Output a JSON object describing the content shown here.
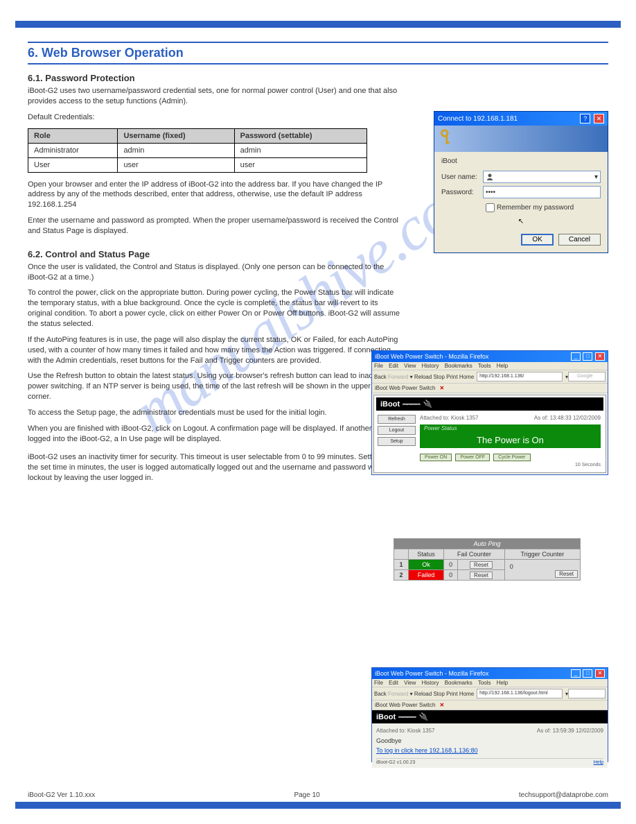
{
  "section_number": "6.",
  "section_title": "Web Browser Operation",
  "sub1_title": "6.1. Password Protection",
  "sub1_p1": "iBoot-G2 uses two username/password credential sets, one for normal power control (User) and one that also provides access to the setup functions (Admin).",
  "sub1_p2": "Default Credentials:",
  "cred_headers": {
    "c1": "Role",
    "c2": "Username (fixed)",
    "c3": "Password (settable)"
  },
  "cred_rows": [
    {
      "role": "Administrator",
      "user": "admin",
      "pass": "admin"
    },
    {
      "role": "User",
      "user": "user",
      "pass": "user"
    }
  ],
  "sub1_p3": "Open your browser and enter the IP address of iBoot-G2 into the address bar. If you have changed the IP address by any of the methods described, enter that address, otherwise, use the default IP address 192.168.1.254",
  "sub1_p4": "Enter the username and password as prompted. When the proper username/password is received the Control and Status Page is displayed.",
  "sub2_title": "6.2. Control and Status Page",
  "sub2_p1": "Once the user is validated, the Control and Status is displayed. (Only one person can be connected to the iBoot-G2 at a time.)",
  "sub2_p2": "To control the power, click on the appropriate button. During power cycling, the Power Status bar will indicate the temporary status, with a blue background. Once the cycle is complete, the status bar will revert to its original condition. To abort a power cycle, click on either Power On or Power Off buttons. iBoot-G2 will assume the status selected.",
  "sub2_p3": "If the AutoPing features is in use, the page will also display the current status, OK or Failed, for each AutoPing used, with a counter of how many times it failed and how many times the Action was triggered. If connecting with the Admin credentials, reset buttons for the Fail and Trigger counters are provided.",
  "sub2_p4": "Use the Refresh button to obtain the latest status. Using your browser's refresh button can lead to inadvertent power switching. If an NTP server is being used, the time of the last refresh will be shown in the upper right corner.",
  "sub2_p5": "To access the Setup page, the administrator credentials must be used for the initial login.",
  "sub2_p6": "When you are finished with iBoot-G2, click on Logout. A confirmation page will be displayed. If another user is logged into the iBoot-G2, a In Use page will be displayed.",
  "sub2_p7": "iBoot-G2 uses an inactivity timer for security. This timeout is user selectable from 0 to 99 minutes. Setting to zero disables the timeout feature. When there is no activity for the set time in minutes, the user is logged automatically logged out and the username and password will need to be entered again for access. This is to prevent accidental lockout by leaving the user logged in.",
  "footer_left": "iBoot-G2 Ver 1.10.xxx",
  "footer_page": "Page 10",
  "footer_right": "techsupport@dataprobe.com",
  "watermark": "manualshive.com",
  "login": {
    "title": "Connect to 192.168.1.181",
    "app_label": "iBoot",
    "user_label": "User name:",
    "user_value": "",
    "pass_label": "Password:",
    "pass_value": "••••",
    "remember": "Remember my password",
    "ok": "OK",
    "cancel": "Cancel"
  },
  "browser_status": {
    "title": "iBoot Web Power Switch - Mozilla Firefox",
    "menus": [
      "File",
      "Edit",
      "View",
      "History",
      "Bookmarks",
      "Tools",
      "Help"
    ],
    "toolbar": [
      "Back",
      "Forward",
      "Reload",
      "Stop",
      "Print",
      "Home"
    ],
    "url": "http://192.168.1.136/",
    "search_placeholder": "Google",
    "tab_label": "iBoot Web Power Switch",
    "iboot_logo": "iBoot",
    "attached": "Attached to: Kiosk 1357",
    "timestamp": "As of: 13:48:33 12/02/2009",
    "sidebar": [
      "Refresh",
      "Logout",
      "Setup"
    ],
    "power_head": "Power Status",
    "power_status": "The Power is On",
    "buttons": [
      "Power ON",
      "Power OFF",
      "Cycle Power"
    ],
    "cycle_time": "10 Seconds"
  },
  "autoping": {
    "title": "Auto Ping",
    "headers": [
      "",
      "Status",
      "Fail Counter",
      "Trigger Counter"
    ],
    "rows": [
      {
        "n": "1",
        "status": "Ok",
        "class": "ok",
        "fail": "0"
      },
      {
        "n": "2",
        "status": "Failed",
        "class": "failed",
        "fail": "0"
      }
    ],
    "trigger": "0",
    "reset": "Reset"
  },
  "browser_logout": {
    "title": "iBoot Web Power Switch - Mozilla Firefox",
    "url": "http://192.168.1.136/logout.html",
    "tab_label": "iBoot Web Power Switch",
    "attached": "Attached to: Kiosk 1357",
    "timestamp": "As of: 13:59:39 12/02/2009",
    "goodbye": "Goodbye",
    "login_link": "To log in click here 192.168.1.136:80",
    "version": "iBoot-G2 v1.00.23",
    "help": "Help"
  }
}
